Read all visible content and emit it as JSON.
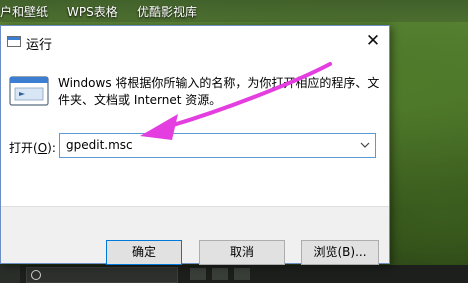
{
  "desktop": {
    "labels": [
      "户和壁纸",
      "WPS表格",
      "优酷影视库"
    ]
  },
  "dialog": {
    "title": "运行",
    "close_glyph": "✕",
    "description": "Windows 将根据你所输入的名称，为你打开相应的程序、文件夹、文档或 Internet 资源。",
    "open_label_prefix": "打开(",
    "open_label_key": "O",
    "open_label_suffix": "):",
    "open_value": "gpedit.msc",
    "buttons": {
      "ok": "确定",
      "cancel": "取消",
      "browse": "浏览(B)..."
    }
  },
  "colors": {
    "annotation_arrow": "#e43ee0",
    "focus_border": "#5a9bd5",
    "default_button_border": "#0078d7"
  },
  "icons": {
    "window_icon": "run-window-icon",
    "run_icon": "run-app-icon",
    "close": "close-icon",
    "dropdown": "chevron-down-icon",
    "annotation": "pink-arrow-annotation"
  }
}
